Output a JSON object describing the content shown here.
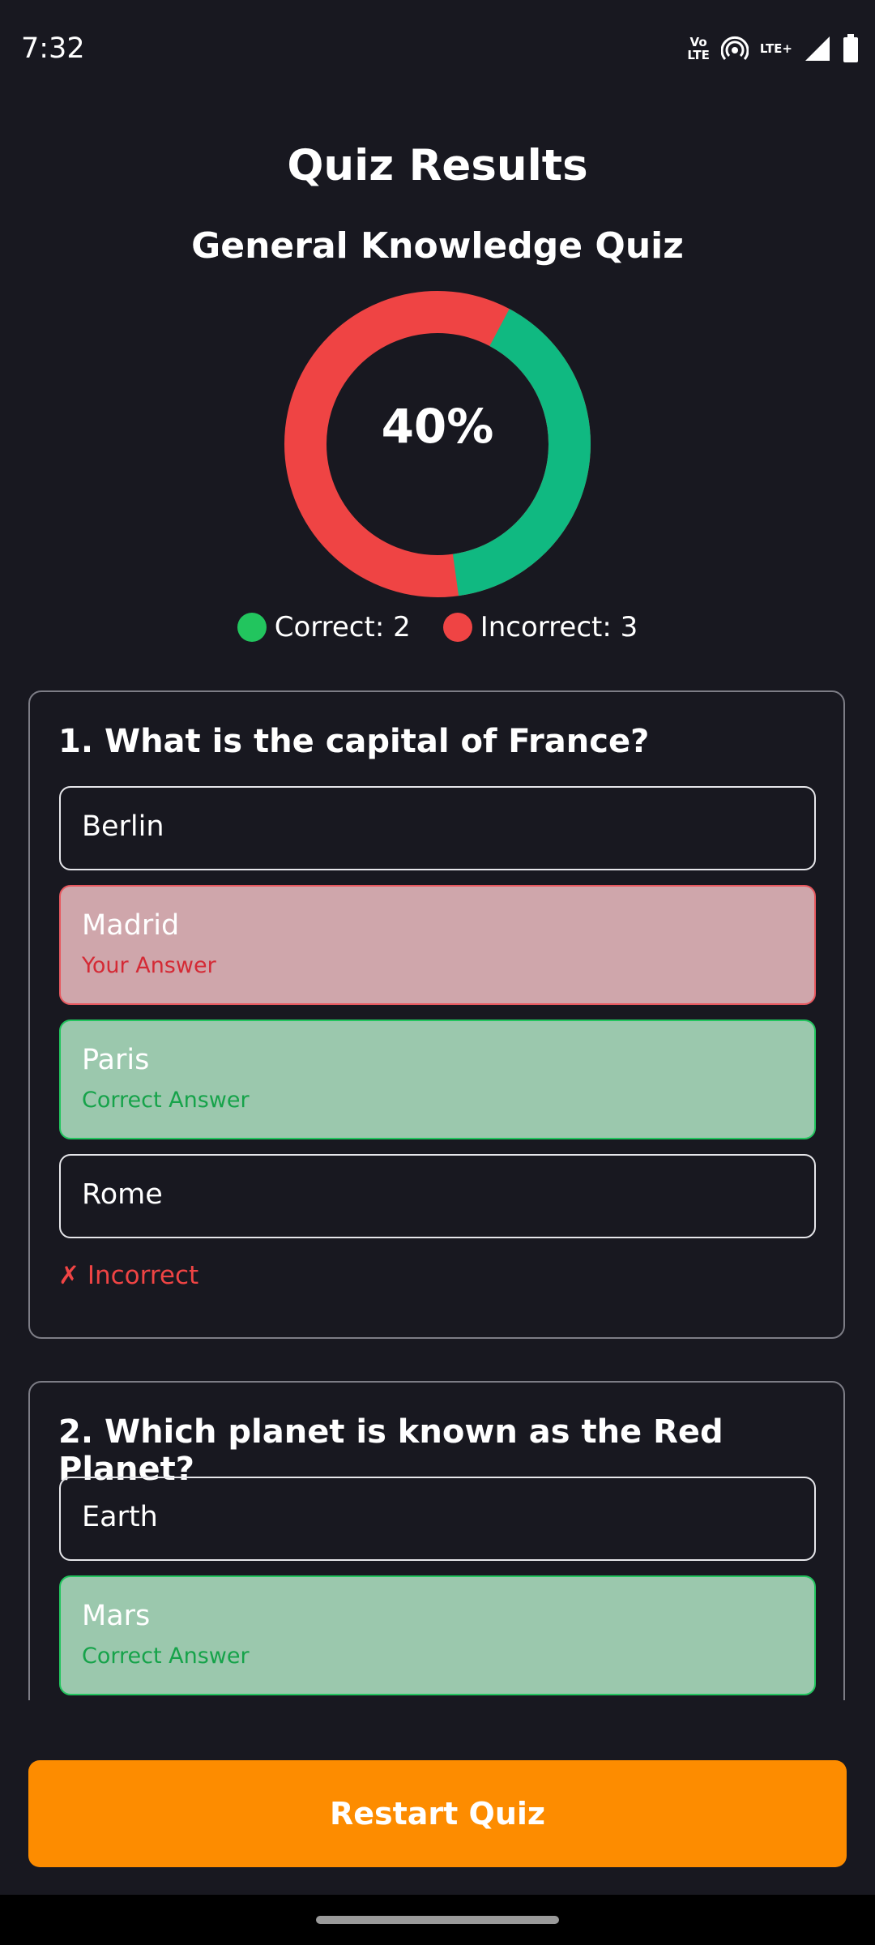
{
  "status_bar": {
    "time": "7:32",
    "volte_top": "Vo",
    "volte_bottom": "LTE",
    "network": "LTE+",
    "icons": [
      "volte-icon",
      "hotspot-icon",
      "signal-icon",
      "battery-icon"
    ]
  },
  "header": {
    "title": "Quiz Results",
    "quiz_name": "General Knowledge Quiz"
  },
  "score": {
    "percent_label": "40%",
    "correct_fraction": 0.4,
    "correct_color": "#10b981",
    "incorrect_color": "#ef4444"
  },
  "legend": {
    "correct": "Correct: 2",
    "incorrect": "Incorrect: 3",
    "correct_dot_color": "#22c55e",
    "incorrect_dot_color": "#ef4444"
  },
  "questions": [
    {
      "text": "1. What is the capital of France?",
      "options": [
        {
          "label": "Berlin"
        },
        {
          "label": "Madrid",
          "note": "Your Answer"
        },
        {
          "label": "Paris",
          "note": "Correct Answer"
        },
        {
          "label": "Rome"
        }
      ],
      "result": "✗ Incorrect"
    },
    {
      "text": "2. Which planet is known as the Red Planet?",
      "options": [
        {
          "label": "Earth"
        },
        {
          "label": "Mars",
          "note": "Correct Answer"
        }
      ]
    }
  ],
  "actions": {
    "restart": "Restart Quiz"
  }
}
